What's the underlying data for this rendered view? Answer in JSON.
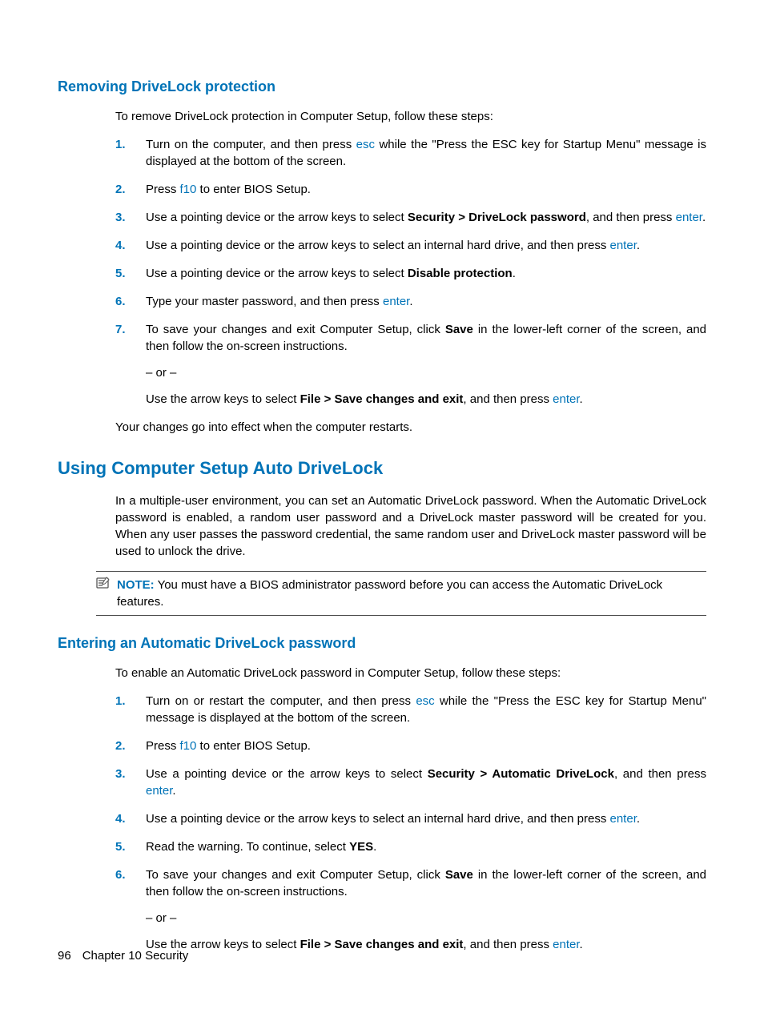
{
  "section1": {
    "heading": "Removing DriveLock protection",
    "intro": "To remove DriveLock protection in Computer Setup, follow these steps:",
    "steps": {
      "s1_a": "Turn on the computer, and then press ",
      "s1_key": "esc",
      "s1_b": " while the \"Press the ESC key for Startup Menu\" message is displayed at the bottom of the screen.",
      "s2_a": "Press ",
      "s2_key": "f10",
      "s2_b": " to enter BIOS Setup.",
      "s3_a": "Use a pointing device or the arrow keys to select ",
      "s3_bold": "Security > DriveLock password",
      "s3_b": ", and then press ",
      "s3_key": "enter",
      "s3_c": ".",
      "s4_a": "Use a pointing device or the arrow keys to select an internal hard drive, and then press ",
      "s4_key": "enter",
      "s4_b": ".",
      "s5_a": "Use a pointing device or the arrow keys to select ",
      "s5_bold": "Disable protection",
      "s5_b": ".",
      "s6_a": "Type your master password, and then press ",
      "s6_key": "enter",
      "s6_b": ".",
      "s7_a": "To save your changes and exit Computer Setup, click ",
      "s7_bold": "Save",
      "s7_b": " in the lower-left corner of the screen, and then follow the on-screen instructions.",
      "s7_or": "– or –",
      "s7_c": "Use the arrow keys to select ",
      "s7_bold2": "File > Save changes and exit",
      "s7_d": ", and then press ",
      "s7_key": "enter",
      "s7_e": "."
    },
    "outro": "Your changes go into effect when the computer restarts."
  },
  "section2": {
    "heading": "Using Computer Setup Auto DriveLock",
    "para": "In a multiple-user environment, you can set an Automatic DriveLock password. When the Automatic DriveLock password is enabled, a random user password and a DriveLock master password will be created for you. When any user passes the password credential, the same random user and DriveLock master password will be used to unlock the drive.",
    "note_label": "NOTE:",
    "note_text": "   You must have a BIOS administrator password before you can access the Automatic DriveLock features."
  },
  "section3": {
    "heading": "Entering an Automatic DriveLock password",
    "intro": "To enable an Automatic DriveLock password in Computer Setup, follow these steps:",
    "steps": {
      "s1_a": "Turn on or restart the computer, and then press ",
      "s1_key": "esc",
      "s1_b": " while the \"Press the ESC key for Startup Menu\" message is displayed at the bottom of the screen.",
      "s2_a": "Press ",
      "s2_key": "f10",
      "s2_b": " to enter BIOS Setup.",
      "s3_a": "Use a pointing device or the arrow keys to select ",
      "s3_bold": "Security > Automatic DriveLock",
      "s3_b": ", and then press ",
      "s3_key": "enter",
      "s3_c": ".",
      "s4_a": "Use a pointing device or the arrow keys to select an internal hard drive, and then press ",
      "s4_key": "enter",
      "s4_b": ".",
      "s5_a": "Read the warning. To continue, select ",
      "s5_bold": "YES",
      "s5_b": ".",
      "s6_a": "To save your changes and exit Computer Setup, click ",
      "s6_bold": "Save",
      "s6_b": " in the lower-left corner of the screen, and then follow the on-screen instructions.",
      "s6_or": "– or –",
      "s6_c": "Use the arrow keys to select ",
      "s6_bold2": "File > Save changes and exit",
      "s6_d": ", and then press ",
      "s6_key": "enter",
      "s6_e": "."
    }
  },
  "nums": [
    "1.",
    "2.",
    "3.",
    "4.",
    "5.",
    "6.",
    "7."
  ],
  "footer": {
    "page": "96",
    "chapter": "Chapter 10   Security"
  }
}
